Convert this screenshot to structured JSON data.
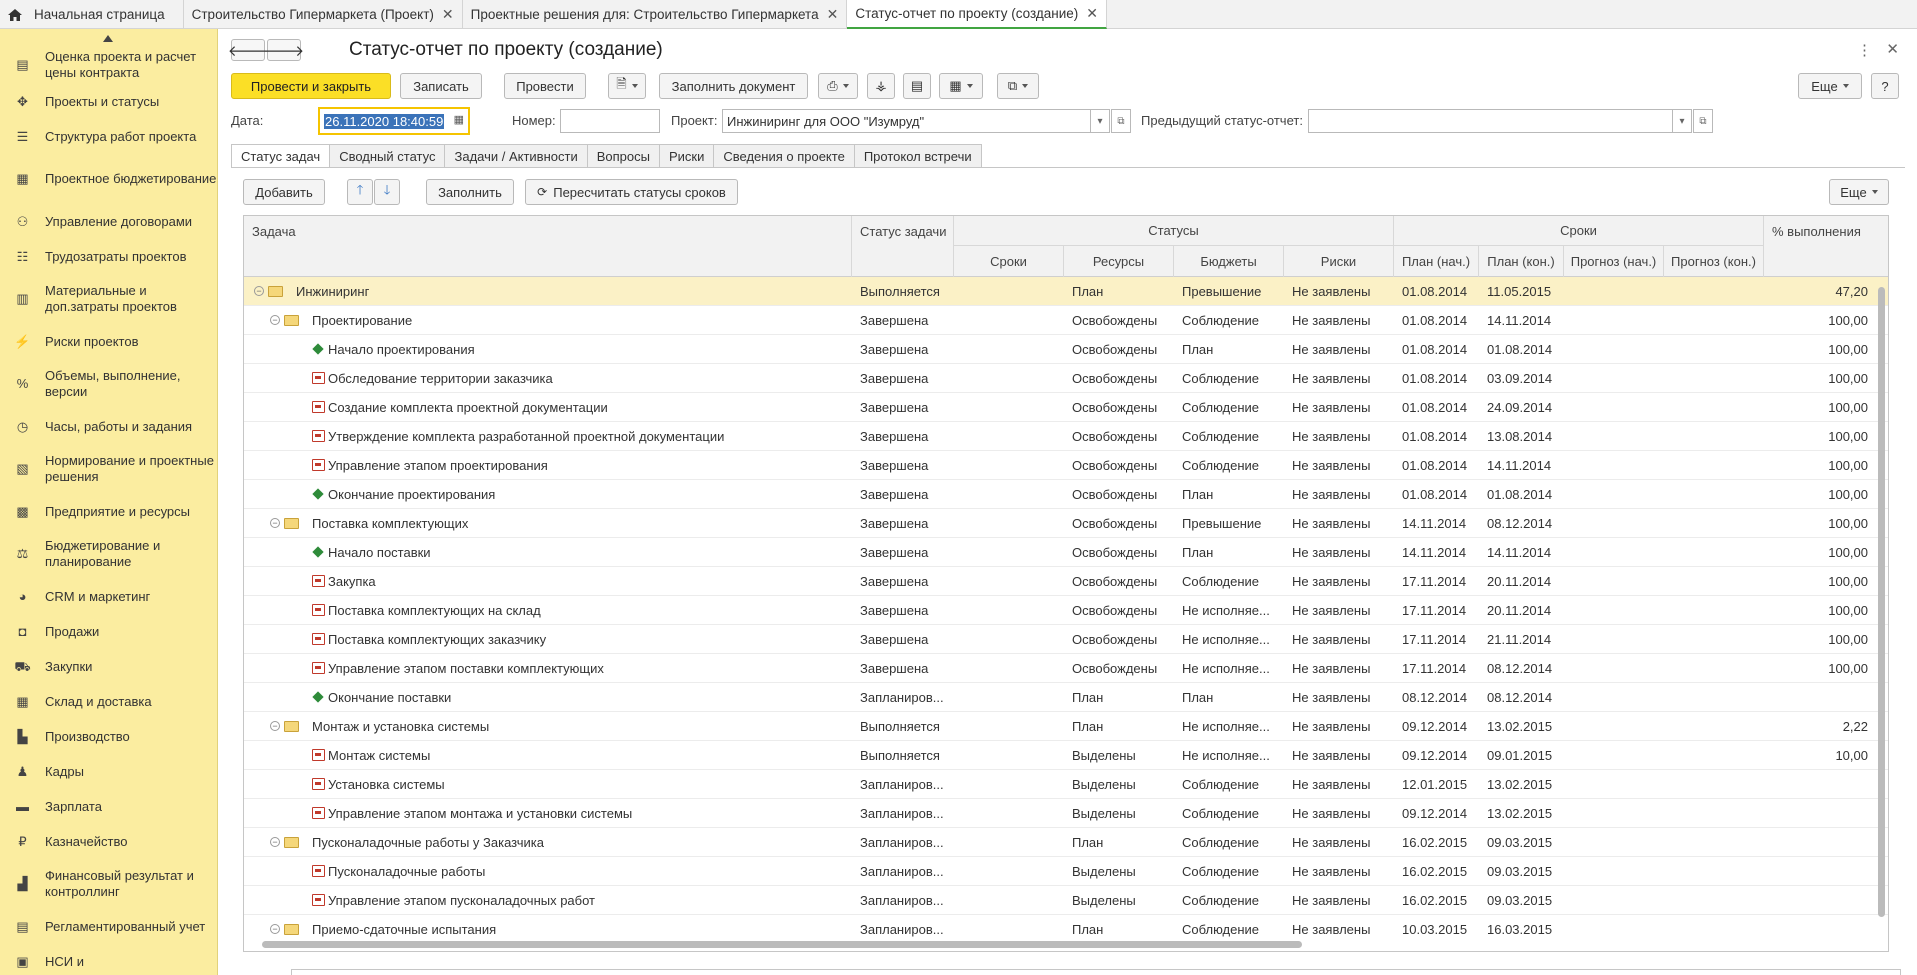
{
  "tabs": [
    {
      "label": "Начальная страница",
      "home": true
    },
    {
      "label": "Строительство Гипермаркета (Проект)",
      "closable": true
    },
    {
      "label": "Проектные решения для: Строительство Гипермаркета",
      "closable": true
    },
    {
      "label": "Статус-отчет по проекту (создание)",
      "closable": true,
      "active": true
    }
  ],
  "sidebar": {
    "items": [
      {
        "label": "Оценка проекта и расчет цены контракта",
        "icon": "calculator-icon"
      },
      {
        "label": "Проекты и статусы",
        "icon": "projects-icon"
      },
      {
        "label": "Структура работ проекта",
        "icon": "structure-icon"
      },
      {
        "label": "Проектное бюджетирование",
        "icon": "budget-icon"
      },
      {
        "label": "Управление договорами",
        "icon": "contracts-icon"
      },
      {
        "label": "Трудозатраты проектов",
        "icon": "labor-icon"
      },
      {
        "label": "Материальные и доп.затраты проектов",
        "icon": "materials-icon"
      },
      {
        "label": "Риски проектов",
        "icon": "risks-icon"
      },
      {
        "label": "Объемы, выполнение, версии",
        "icon": "percent-icon"
      },
      {
        "label": "Часы, работы и задания",
        "icon": "hours-icon"
      },
      {
        "label": "Нормирование и проектные решения",
        "icon": "norms-icon"
      },
      {
        "label": "Предприятие и ресурсы",
        "icon": "enterprise-icon"
      },
      {
        "label": "Бюджетирование и планирование",
        "icon": "planning-icon"
      },
      {
        "label": "CRM и маркетинг",
        "icon": "crm-icon"
      },
      {
        "label": "Продажи",
        "icon": "sales-icon"
      },
      {
        "label": "Закупки",
        "icon": "cart-icon"
      },
      {
        "label": "Склад и доставка",
        "icon": "warehouse-icon"
      },
      {
        "label": "Производство",
        "icon": "factory-icon"
      },
      {
        "label": "Кадры",
        "icon": "person-icon"
      },
      {
        "label": "Зарплата",
        "icon": "salary-icon"
      },
      {
        "label": "Казначейство",
        "icon": "treasury-icon"
      },
      {
        "label": "Финансовый результат и контроллинг",
        "icon": "finance-icon"
      },
      {
        "label": "Регламентированный учет",
        "icon": "accounting-icon"
      },
      {
        "label": "НСИ и",
        "icon": "nsi-icon"
      }
    ]
  },
  "header": {
    "title": "Статус-отчет по проекту (создание)"
  },
  "toolbar": {
    "post_close": "Провести и закрыть",
    "save": "Записать",
    "post": "Провести",
    "fill_document": "Заполнить документ",
    "more": "Еще",
    "help": "?"
  },
  "form": {
    "date_label": "Дата:",
    "date_value": "26.11.2020 18:40:59",
    "number_label": "Номер:",
    "number_value": "",
    "project_label": "Проект:",
    "project_value": "Инжиниринг для ООО \"Изумруд\"",
    "prev_label": "Предыдущий статус-отчет:",
    "prev_value": ""
  },
  "inner_tabs": [
    "Статус задач",
    "Сводный статус",
    "Задачи / Активности",
    "Вопросы",
    "Риски",
    "Сведения о проекте",
    "Протокол встречи"
  ],
  "grid_toolbar": {
    "add": "Добавить",
    "fill": "Заполнить",
    "recalc": "Пересчитать статусы сроков",
    "more": "Еще"
  },
  "grid": {
    "headers": {
      "task": "Задача",
      "task_status": "Статус задачи",
      "statuses": "Статусы",
      "deadlines": "Сроки",
      "statuses_sub": [
        "Сроки",
        "Ресурсы",
        "Бюджеты",
        "Риски"
      ],
      "deadlines_sub": [
        "План (нач.)",
        "План (кон.)",
        "Прогноз (нач.)",
        "Прогноз (кон.)"
      ],
      "percent": "% выполнения"
    },
    "rows": [
      {
        "level": 0,
        "kind": "folder",
        "name": "Инжиниринг",
        "status": "Выполняется",
        "s_term": "",
        "s_res": "План",
        "s_budget": "Превышение",
        "s_risk": "Не заявлены",
        "plan_start": "01.08.2014",
        "plan_end": "11.05.2015",
        "fc_start": "",
        "fc_end": "",
        "pct": "47,20",
        "selected": true
      },
      {
        "level": 1,
        "kind": "folder",
        "name": "Проектирование",
        "status": "Завершена",
        "s_term": "",
        "s_res": "Освобождены",
        "s_budget": "Соблюдение",
        "s_risk": "Не заявлены",
        "plan_start": "01.08.2014",
        "plan_end": "14.11.2014",
        "fc_start": "",
        "fc_end": "",
        "pct": "100,00"
      },
      {
        "level": 2,
        "kind": "milestone",
        "name": "Начало проектирования",
        "status": "Завершена",
        "s_term": "",
        "s_res": "Освобождены",
        "s_budget": "План",
        "s_risk": "Не заявлены",
        "plan_start": "01.08.2014",
        "plan_end": "01.08.2014",
        "fc_start": "",
        "fc_end": "",
        "pct": "100,00"
      },
      {
        "level": 2,
        "kind": "task",
        "name": "Обследование территории заказчика",
        "status": "Завершена",
        "s_term": "",
        "s_res": "Освобождены",
        "s_budget": "Соблюдение",
        "s_risk": "Не заявлены",
        "plan_start": "01.08.2014",
        "plan_end": "03.09.2014",
        "fc_start": "",
        "fc_end": "",
        "pct": "100,00"
      },
      {
        "level": 2,
        "kind": "task",
        "name": "Создание комплекта проектной документации",
        "status": "Завершена",
        "s_term": "",
        "s_res": "Освобождены",
        "s_budget": "Соблюдение",
        "s_risk": "Не заявлены",
        "plan_start": "01.08.2014",
        "plan_end": "24.09.2014",
        "fc_start": "",
        "fc_end": "",
        "pct": "100,00"
      },
      {
        "level": 2,
        "kind": "task",
        "name": "Утверждение комплекта разработанной проектной документации",
        "status": "Завершена",
        "s_term": "",
        "s_res": "Освобождены",
        "s_budget": "Соблюдение",
        "s_risk": "Не заявлены",
        "plan_start": "01.08.2014",
        "plan_end": "13.08.2014",
        "fc_start": "",
        "fc_end": "",
        "pct": "100,00"
      },
      {
        "level": 2,
        "kind": "task",
        "name": "Управление этапом проектирования",
        "status": "Завершена",
        "s_term": "",
        "s_res": "Освобождены",
        "s_budget": "Соблюдение",
        "s_risk": "Не заявлены",
        "plan_start": "01.08.2014",
        "plan_end": "14.11.2014",
        "fc_start": "",
        "fc_end": "",
        "pct": "100,00"
      },
      {
        "level": 2,
        "kind": "milestone",
        "name": "Окончание проектирования",
        "status": "Завершена",
        "s_term": "",
        "s_res": "Освобождены",
        "s_budget": "План",
        "s_risk": "Не заявлены",
        "plan_start": "01.08.2014",
        "plan_end": "01.08.2014",
        "fc_start": "",
        "fc_end": "",
        "pct": "100,00"
      },
      {
        "level": 1,
        "kind": "folder",
        "name": "Поставка комплектующих",
        "status": "Завершена",
        "s_term": "",
        "s_res": "Освобождены",
        "s_budget": "Превышение",
        "s_risk": "Не заявлены",
        "plan_start": "14.11.2014",
        "plan_end": "08.12.2014",
        "fc_start": "",
        "fc_end": "",
        "pct": "100,00"
      },
      {
        "level": 2,
        "kind": "milestone",
        "name": "Начало поставки",
        "status": "Завершена",
        "s_term": "",
        "s_res": "Освобождены",
        "s_budget": "План",
        "s_risk": "Не заявлены",
        "plan_start": "14.11.2014",
        "plan_end": "14.11.2014",
        "fc_start": "",
        "fc_end": "",
        "pct": "100,00"
      },
      {
        "level": 2,
        "kind": "task",
        "name": "Закупка",
        "status": "Завершена",
        "s_term": "",
        "s_res": "Освобождены",
        "s_budget": "Соблюдение",
        "s_risk": "Не заявлены",
        "plan_start": "17.11.2014",
        "plan_end": "20.11.2014",
        "fc_start": "",
        "fc_end": "",
        "pct": "100,00"
      },
      {
        "level": 2,
        "kind": "task",
        "name": "Поставка комплектующих на склад",
        "status": "Завершена",
        "s_term": "",
        "s_res": "Освобождены",
        "s_budget": "Не исполняе...",
        "s_risk": "Не заявлены",
        "plan_start": "17.11.2014",
        "plan_end": "20.11.2014",
        "fc_start": "",
        "fc_end": "",
        "pct": "100,00"
      },
      {
        "level": 2,
        "kind": "task",
        "name": "Поставка комплектующих заказчику",
        "status": "Завершена",
        "s_term": "",
        "s_res": "Освобождены",
        "s_budget": "Не исполняе...",
        "s_risk": "Не заявлены",
        "plan_start": "17.11.2014",
        "plan_end": "21.11.2014",
        "fc_start": "",
        "fc_end": "",
        "pct": "100,00"
      },
      {
        "level": 2,
        "kind": "task",
        "name": "Управление этапом поставки комплектующих",
        "status": "Завершена",
        "s_term": "",
        "s_res": "Освобождены",
        "s_budget": "Не исполняе...",
        "s_risk": "Не заявлены",
        "plan_start": "17.11.2014",
        "plan_end": "08.12.2014",
        "fc_start": "",
        "fc_end": "",
        "pct": "100,00"
      },
      {
        "level": 2,
        "kind": "milestone",
        "name": "Окончание поставки",
        "status": "Запланиров...",
        "s_term": "",
        "s_res": "План",
        "s_budget": "План",
        "s_risk": "Не заявлены",
        "plan_start": "08.12.2014",
        "plan_end": "08.12.2014",
        "fc_start": "",
        "fc_end": "",
        "pct": ""
      },
      {
        "level": 1,
        "kind": "folder",
        "name": "Монтаж и установка системы",
        "status": "Выполняется",
        "s_term": "",
        "s_res": "План",
        "s_budget": "Не исполняе...",
        "s_risk": "Не заявлены",
        "plan_start": "09.12.2014",
        "plan_end": "13.02.2015",
        "fc_start": "",
        "fc_end": "",
        "pct": "2,22"
      },
      {
        "level": 2,
        "kind": "task",
        "name": "Монтаж системы",
        "status": "Выполняется",
        "s_term": "",
        "s_res": "Выделены",
        "s_budget": "Не исполняе...",
        "s_risk": "Не заявлены",
        "plan_start": "09.12.2014",
        "plan_end": "09.01.2015",
        "fc_start": "",
        "fc_end": "",
        "pct": "10,00"
      },
      {
        "level": 2,
        "kind": "task",
        "name": "Установка системы",
        "status": "Запланиров...",
        "s_term": "",
        "s_res": "Выделены",
        "s_budget": "Соблюдение",
        "s_risk": "Не заявлены",
        "plan_start": "12.01.2015",
        "plan_end": "13.02.2015",
        "fc_start": "",
        "fc_end": "",
        "pct": ""
      },
      {
        "level": 2,
        "kind": "task",
        "name": "Управление этапом монтажа и установки системы",
        "status": "Запланиров...",
        "s_term": "",
        "s_res": "Выделены",
        "s_budget": "Соблюдение",
        "s_risk": "Не заявлены",
        "plan_start": "09.12.2014",
        "plan_end": "13.02.2015",
        "fc_start": "",
        "fc_end": "",
        "pct": ""
      },
      {
        "level": 1,
        "kind": "folder",
        "name": "Пусконаладочные работы у Заказчика",
        "status": "Запланиров...",
        "s_term": "",
        "s_res": "План",
        "s_budget": "Соблюдение",
        "s_risk": "Не заявлены",
        "plan_start": "16.02.2015",
        "plan_end": "09.03.2015",
        "fc_start": "",
        "fc_end": "",
        "pct": ""
      },
      {
        "level": 2,
        "kind": "task",
        "name": "Пусконаладочные работы",
        "status": "Запланиров...",
        "s_term": "",
        "s_res": "Выделены",
        "s_budget": "Соблюдение",
        "s_risk": "Не заявлены",
        "plan_start": "16.02.2015",
        "plan_end": "09.03.2015",
        "fc_start": "",
        "fc_end": "",
        "pct": ""
      },
      {
        "level": 2,
        "kind": "task",
        "name": "Управление этапом пусконаладочных работ",
        "status": "Запланиров...",
        "s_term": "",
        "s_res": "Выделены",
        "s_budget": "Соблюдение",
        "s_risk": "Не заявлены",
        "plan_start": "16.02.2015",
        "plan_end": "09.03.2015",
        "fc_start": "",
        "fc_end": "",
        "pct": ""
      },
      {
        "level": 1,
        "kind": "folder",
        "name": "Приемо-сдаточные испытания",
        "status": "Запланиров...",
        "s_term": "",
        "s_res": "План",
        "s_budget": "Соблюдение",
        "s_risk": "Не заявлены",
        "plan_start": "10.03.2015",
        "plan_end": "16.03.2015",
        "fc_start": "",
        "fc_end": "",
        "pct": ""
      }
    ]
  }
}
